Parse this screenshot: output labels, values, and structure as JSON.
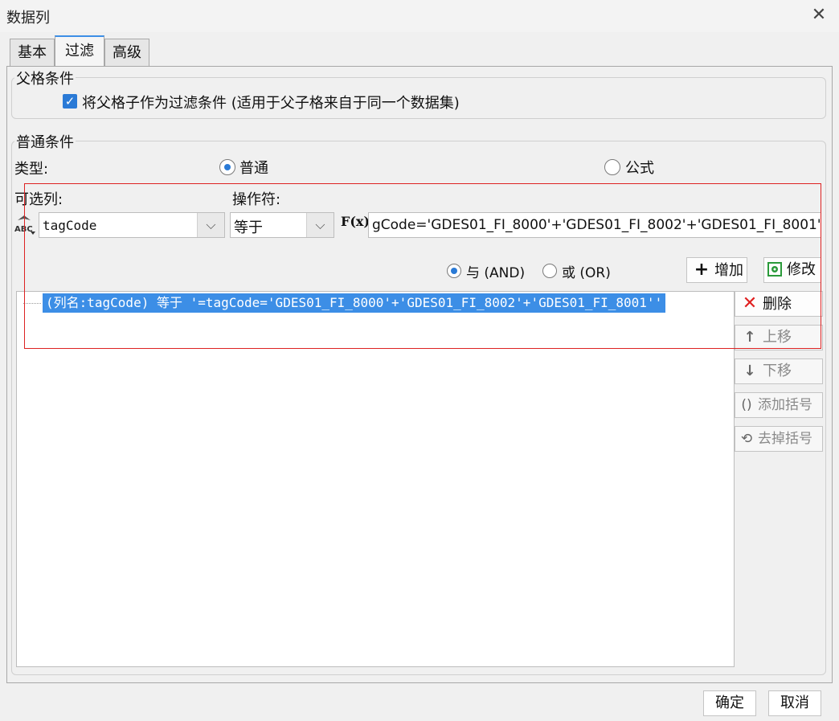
{
  "window": {
    "title": "数据列",
    "close_glyph": "✕"
  },
  "tabs": [
    {
      "label": "基本"
    },
    {
      "label": "过滤"
    },
    {
      "label": "高级"
    }
  ],
  "parent_condition": {
    "legend": "父格条件",
    "checkbox_label": "将父格子作为过滤条件 (适用于父子格来自于同一个数据集)",
    "checked": true
  },
  "normal_condition": {
    "legend": "普通条件",
    "type_label": "类型:",
    "type_options": [
      {
        "label": "普通",
        "selected": true
      },
      {
        "label": "公式",
        "selected": false
      }
    ],
    "column_label": "可选列:",
    "column_value": "tagCode",
    "operator_label": "操作符:",
    "operator_value": "等于",
    "formula_icon": "F(x)",
    "value_text": "gCode='GDES01_FI_8000'+'GDES01_FI_8002'+'GDES01_FI_8001'",
    "logic_options": [
      {
        "label": "与 (AND)",
        "selected": true
      },
      {
        "label": "或 (OR)",
        "selected": false
      }
    ],
    "add_label": "增加",
    "modify_label": "修改"
  },
  "conditions_list": [
    "(列名:tagCode) 等于 '=tagCode='GDES01_FI_8000'+'GDES01_FI_8002'+'GDES01_FI_8001''"
  ],
  "side_buttons": {
    "delete": "删除",
    "move_up": "上移",
    "move_down": "下移",
    "add_bracket": "添加括号",
    "remove_bracket": "去掉括号"
  },
  "footer": {
    "ok": "确定",
    "cancel": "取消"
  }
}
